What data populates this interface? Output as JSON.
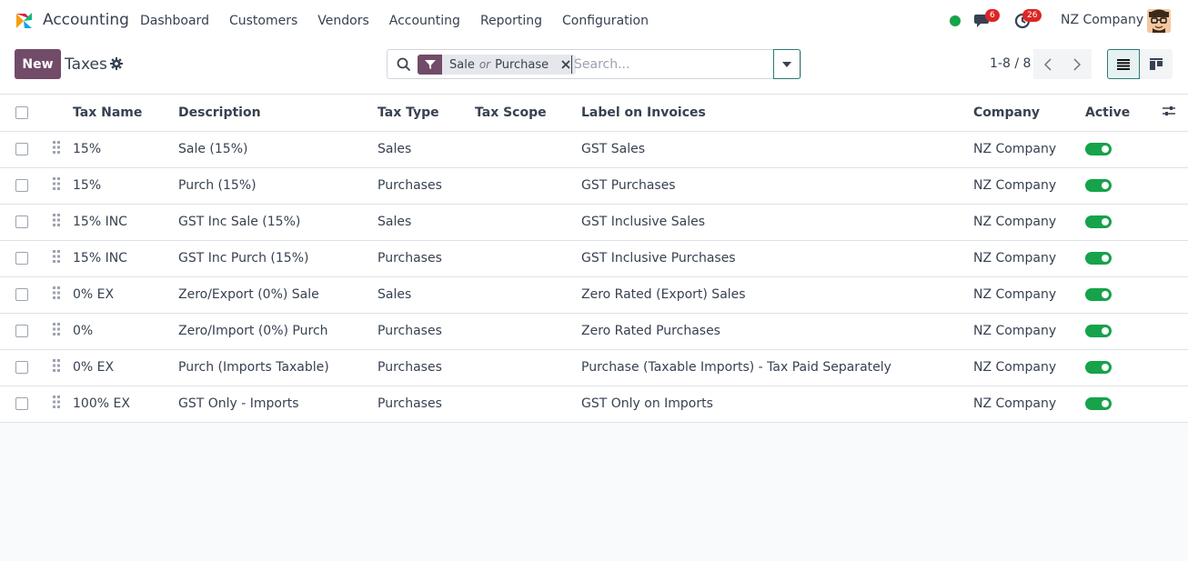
{
  "navbar": {
    "app_name": "Accounting",
    "menu": [
      "Dashboard",
      "Customers",
      "Vendors",
      "Accounting",
      "Reporting",
      "Configuration"
    ],
    "chat_count": "6",
    "activity_count": "26",
    "company": "NZ Company"
  },
  "control": {
    "new_label": "New",
    "title": "Taxes",
    "facet_values": [
      "Sale",
      "Purchase"
    ],
    "facet_or": "or",
    "search_placeholder": "Search...",
    "pager": "1-8 / 8"
  },
  "table": {
    "headers": {
      "tax_name": "Tax Name",
      "description": "Description",
      "tax_type": "Tax Type",
      "tax_scope": "Tax Scope",
      "label": "Label on Invoices",
      "company": "Company",
      "active": "Active"
    },
    "rows": [
      {
        "tax_name": "15%",
        "description": "Sale (15%)",
        "tax_type": "Sales",
        "tax_scope": "",
        "label": "GST Sales",
        "company": "NZ Company",
        "active": true
      },
      {
        "tax_name": "15%",
        "description": "Purch (15%)",
        "tax_type": "Purchases",
        "tax_scope": "",
        "label": "GST Purchases",
        "company": "NZ Company",
        "active": true
      },
      {
        "tax_name": "15% INC",
        "description": "GST Inc Sale (15%)",
        "tax_type": "Sales",
        "tax_scope": "",
        "label": "GST Inclusive Sales",
        "company": "NZ Company",
        "active": true
      },
      {
        "tax_name": "15% INC",
        "description": "GST Inc Purch (15%)",
        "tax_type": "Purchases",
        "tax_scope": "",
        "label": "GST Inclusive Purchases",
        "company": "NZ Company",
        "active": true
      },
      {
        "tax_name": "0% EX",
        "description": "Zero/Export (0%) Sale",
        "tax_type": "Sales",
        "tax_scope": "",
        "label": "Zero Rated (Export) Sales",
        "company": "NZ Company",
        "active": true
      },
      {
        "tax_name": "0%",
        "description": "Zero/Import (0%) Purch",
        "tax_type": "Purchases",
        "tax_scope": "",
        "label": "Zero Rated Purchases",
        "company": "NZ Company",
        "active": true
      },
      {
        "tax_name": "0% EX",
        "description": "Purch (Imports Taxable)",
        "tax_type": "Purchases",
        "tax_scope": "",
        "label": "Purchase (Taxable Imports) - Tax Paid Separately",
        "company": "NZ Company",
        "active": true
      },
      {
        "tax_name": "100% EX",
        "description": "GST Only - Imports",
        "tax_type": "Purchases",
        "tax_scope": "",
        "label": "GST Only on Imports",
        "company": "NZ Company",
        "active": true
      }
    ]
  },
  "colors": {
    "brand": "#714b67",
    "toggle_on": "#16a34a",
    "status_online": "#16a34a",
    "badge": "#dc2626"
  },
  "icons": {
    "app": "accounting-logo-icon",
    "chat": "chat-icon",
    "activity": "clock-icon",
    "settings": "gear-icon",
    "search": "search-icon",
    "filter": "filter-icon",
    "close": "close-icon",
    "dropdown": "caret-down-icon",
    "prev": "chevron-left-icon",
    "next": "chevron-right-icon",
    "list_view": "list-view-icon",
    "kanban_view": "kanban-view-icon",
    "optional_columns": "sliders-icon",
    "drag": "drag-handle-icon"
  }
}
